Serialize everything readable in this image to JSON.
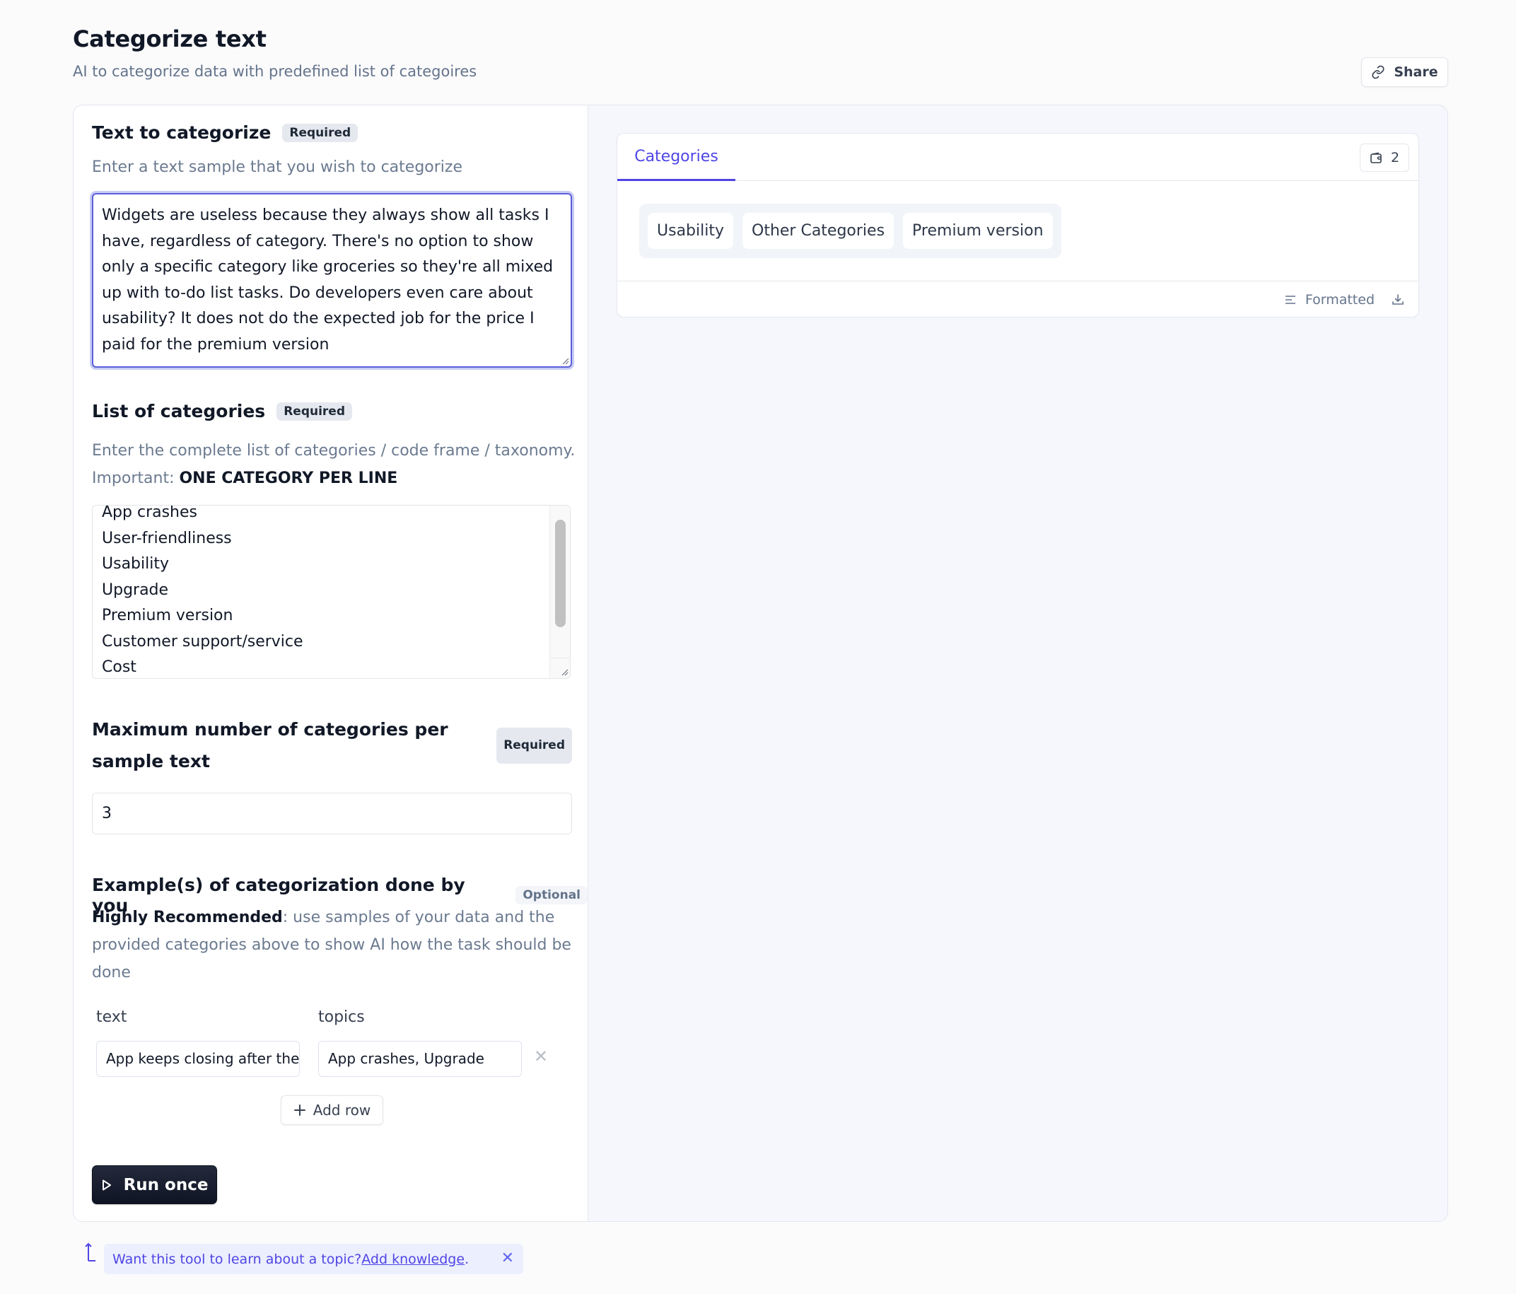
{
  "header": {
    "title": "Categorize text",
    "subtitle": "AI to categorize data with predefined list of categoires",
    "share_label": "Share"
  },
  "form": {
    "text_field": {
      "label": "Text to categorize",
      "badge": "Required",
      "description": "Enter a text sample that you wish to categorize",
      "value": "Widgets are useless because they always show all tasks I have, regardless of category. There's no option to show only a specific category like groceries so they're all mixed up with to-do list tasks. Do developers even care about usability? It does not do the expected job for the price I paid for the premium version"
    },
    "categories_field": {
      "label": "List of categories",
      "badge": "Required",
      "description_line1": "Enter the complete list of categories / code frame / taxonomy.",
      "description_prefix": "Important: ",
      "description_emphasis": "ONE CATEGORY PER LINE",
      "visible_lines": [
        "App crashes",
        "User-friendliness",
        "Usability",
        "Upgrade",
        "Premium version",
        "Customer support/service",
        "Cost"
      ]
    },
    "max_field": {
      "label": "Maximum number of categories per sample text",
      "badge": "Required",
      "value": "3"
    },
    "examples_field": {
      "label": "Example(s) of categorization done by you",
      "badge": "Optional",
      "description_emphasis": "Highly Recommended",
      "description_rest": ": use samples of your data and the provided categories above to show AI how the task should be done",
      "columns": [
        "text",
        "topics"
      ],
      "rows": [
        {
          "text": "App keeps closing after the l",
          "topics": "App crashes, Upgrade"
        }
      ],
      "add_row_label": "Add row"
    },
    "run_label": "Run once"
  },
  "output": {
    "tab_label": "Categories",
    "count": "2",
    "chips": [
      "Usability",
      "Other Categories",
      "Premium version"
    ],
    "format_label": "Formatted"
  },
  "banner": {
    "text": "Want this tool to learn about a topic? ",
    "link": "Add knowledge",
    "suffix": ".",
    "close": "✕"
  },
  "colors": {
    "accent": "#4f46e5",
    "run_button": "#111827",
    "focus_ring": "#c7cbf5"
  }
}
